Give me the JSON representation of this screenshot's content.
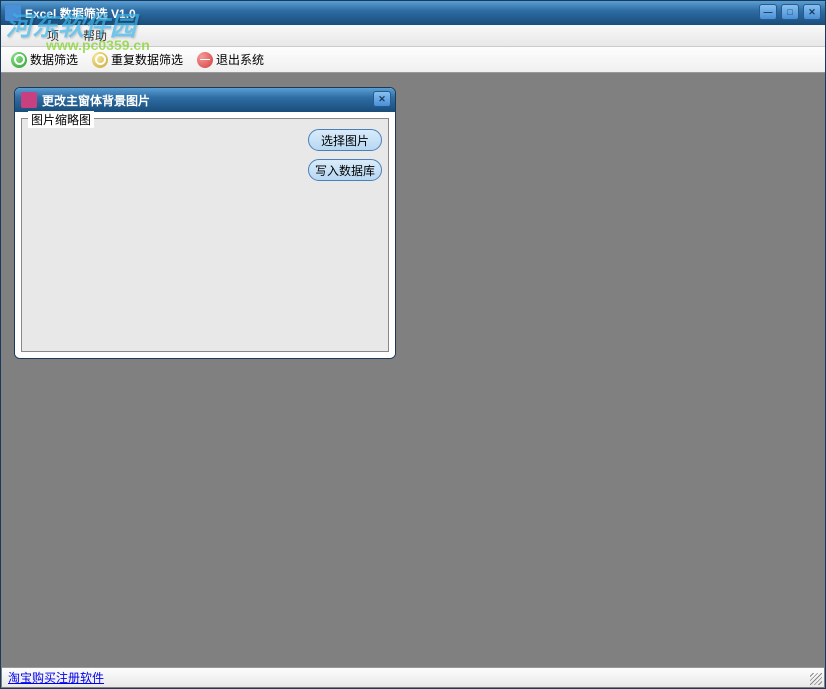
{
  "window": {
    "title": "Excel 数据筛选 V1.0"
  },
  "menubar": {
    "item1": "项",
    "item2": "帮助"
  },
  "toolbar": {
    "filter": "数据筛选",
    "dup_filter": "重复数据筛选",
    "exit": "退出系统"
  },
  "child_window": {
    "title": "更改主窗体背景图片",
    "fieldset_label": "图片缩略图",
    "select_button": "选择图片",
    "write_button": "写入数据库"
  },
  "statusbar": {
    "link_text": "淘宝购买注册软件"
  },
  "watermark": {
    "site_name": "河东软件园",
    "site_url": "www.pc0359.cn"
  }
}
